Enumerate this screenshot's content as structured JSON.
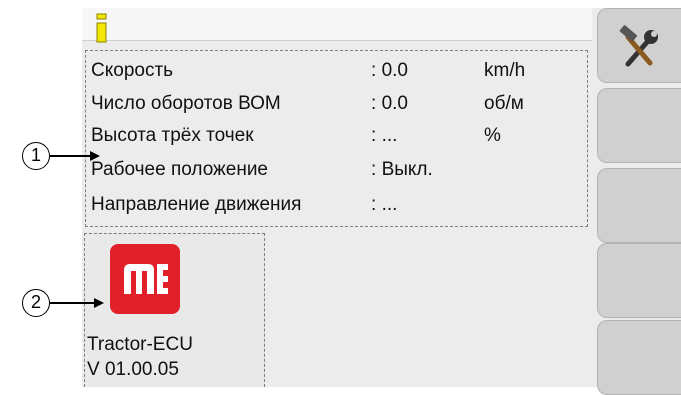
{
  "header": {
    "info_icon": "info-i-icon",
    "info_color": "#f2e600"
  },
  "status_panel": {
    "rows": [
      {
        "label": "Скорость",
        "sep": ":",
        "value": "0.0",
        "unit": "km/h"
      },
      {
        "label": "Число оборотов ВОМ",
        "sep": ":",
        "value": "0.0",
        "unit": "об/м"
      },
      {
        "label": "Высота трёх точек",
        "sep": ":",
        "value": "...",
        "unit": "%"
      },
      {
        "label": "Рабочее положение",
        "sep": ":",
        "value": "Выкл.",
        "unit": ""
      },
      {
        "label": "Направление движения",
        "sep": ":",
        "value": "...",
        "unit": ""
      }
    ]
  },
  "ecu": {
    "logo_text": "ME",
    "logo_color": "#e2202a",
    "name": "Tractor-ECU",
    "version": "V 01.00.05"
  },
  "softkeys": [
    {
      "icon": "tools-icon"
    },
    {
      "icon": ""
    },
    {
      "icon": ""
    },
    {
      "icon": ""
    },
    {
      "icon": ""
    }
  ],
  "callouts": [
    "1",
    "2"
  ]
}
